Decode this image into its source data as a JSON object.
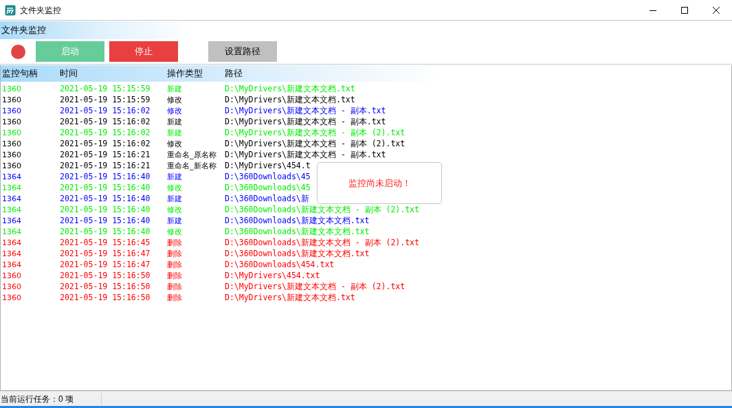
{
  "window": {
    "title": "文件夹监控"
  },
  "section": {
    "title": "文件夹监控"
  },
  "indicator": {
    "running": false
  },
  "buttons": [
    {
      "label": "启动",
      "kind": "start"
    },
    {
      "label": "停止",
      "kind": "stop"
    },
    {
      "label": "设置路径",
      "kind": "settings"
    }
  ],
  "table": {
    "columns": [
      "监控句柄",
      "时间",
      "操作类型",
      "路径"
    ],
    "rows": [
      {
        "handle": "1360",
        "time": "2021-05-19 15:15:59",
        "action": "新建",
        "path": "D:\\MyDrivers\\新建文本文档.txt",
        "color": "#00ee00"
      },
      {
        "handle": "1360",
        "time": "2021-05-19 15:15:59",
        "action": "修改",
        "path": "D:\\MyDrivers\\新建文本文档.txt",
        "color": "#000000"
      },
      {
        "handle": "1360",
        "time": "2021-05-19 15:16:02",
        "action": "修改",
        "path": "D:\\MyDrivers\\新建文本文档 - 副本.txt",
        "color": "#0000ff"
      },
      {
        "handle": "1360",
        "time": "2021-05-19 15:16:02",
        "action": "新建",
        "path": "D:\\MyDrivers\\新建文本文档 - 副本.txt",
        "color": "#000000"
      },
      {
        "handle": "1360",
        "time": "2021-05-19 15:16:02",
        "action": "新建",
        "path": "D:\\MyDrivers\\新建文本文档 - 副本 (2).txt",
        "color": "#00ee00"
      },
      {
        "handle": "1360",
        "time": "2021-05-19 15:16:02",
        "action": "修改",
        "path": "D:\\MyDrivers\\新建文本文档 - 副本 (2).txt",
        "color": "#000000"
      },
      {
        "handle": "1360",
        "time": "2021-05-19 15:16:21",
        "action": "重命名_原名称",
        "path": "D:\\MyDrivers\\新建文本文档 - 副本.txt",
        "color": "#000000"
      },
      {
        "handle": "1360",
        "time": "2021-05-19 15:16:21",
        "action": "重命名_新名称",
        "path": "D:\\MyDrivers\\454.t",
        "color": "#000000"
      },
      {
        "handle": "1364",
        "time": "2021-05-19 15:16:40",
        "action": "新建",
        "path": "D:\\360Downloads\\45",
        "color": "#0000ff"
      },
      {
        "handle": "1364",
        "time": "2021-05-19 15:16:40",
        "action": "修改",
        "path": "D:\\360Downloads\\45",
        "color": "#00ee00"
      },
      {
        "handle": "1364",
        "time": "2021-05-19 15:16:40",
        "action": "新建",
        "path": "D:\\360Downloads\\新",
        "color": "#0000ff"
      },
      {
        "handle": "1364",
        "time": "2021-05-19 15:16:40",
        "action": "修改",
        "path": "D:\\360Downloads\\新建文本文档 - 副本 (2).txt",
        "color": "#00ee00"
      },
      {
        "handle": "1364",
        "time": "2021-05-19 15:16:40",
        "action": "新建",
        "path": "D:\\360Downloads\\新建文本文档.txt",
        "color": "#0000ff"
      },
      {
        "handle": "1364",
        "time": "2021-05-19 15:16:40",
        "action": "修改",
        "path": "D:\\360Downloads\\新建文本文档.txt",
        "color": "#00ee00"
      },
      {
        "handle": "1364",
        "time": "2021-05-19 15:16:45",
        "action": "删除",
        "path": "D:\\360Downloads\\新建文本文档 - 副本 (2).txt",
        "color": "#ff0000"
      },
      {
        "handle": "1364",
        "time": "2021-05-19 15:16:47",
        "action": "删除",
        "path": "D:\\360Downloads\\新建文本文档.txt",
        "color": "#ff0000"
      },
      {
        "handle": "1364",
        "time": "2021-05-19 15:16:47",
        "action": "删除",
        "path": "D:\\360Downloads\\454.txt",
        "color": "#ff0000"
      },
      {
        "handle": "1360",
        "time": "2021-05-19 15:16:50",
        "action": "删除",
        "path": "D:\\MyDrivers\\454.txt",
        "color": "#ff0000"
      },
      {
        "handle": "1360",
        "time": "2021-05-19 15:16:50",
        "action": "删除",
        "path": "D:\\MyDrivers\\新建文本文档 - 副本 (2).txt",
        "color": "#ff0000"
      },
      {
        "handle": "1360",
        "time": "2021-05-19 15:16:50",
        "action": "删除",
        "path": "D:\\MyDrivers\\新建文本文档.txt",
        "color": "#ff0000"
      }
    ]
  },
  "toast": {
    "message": "监控尚未启动！"
  },
  "status_bar": {
    "text": "当前运行任务：0 项"
  }
}
